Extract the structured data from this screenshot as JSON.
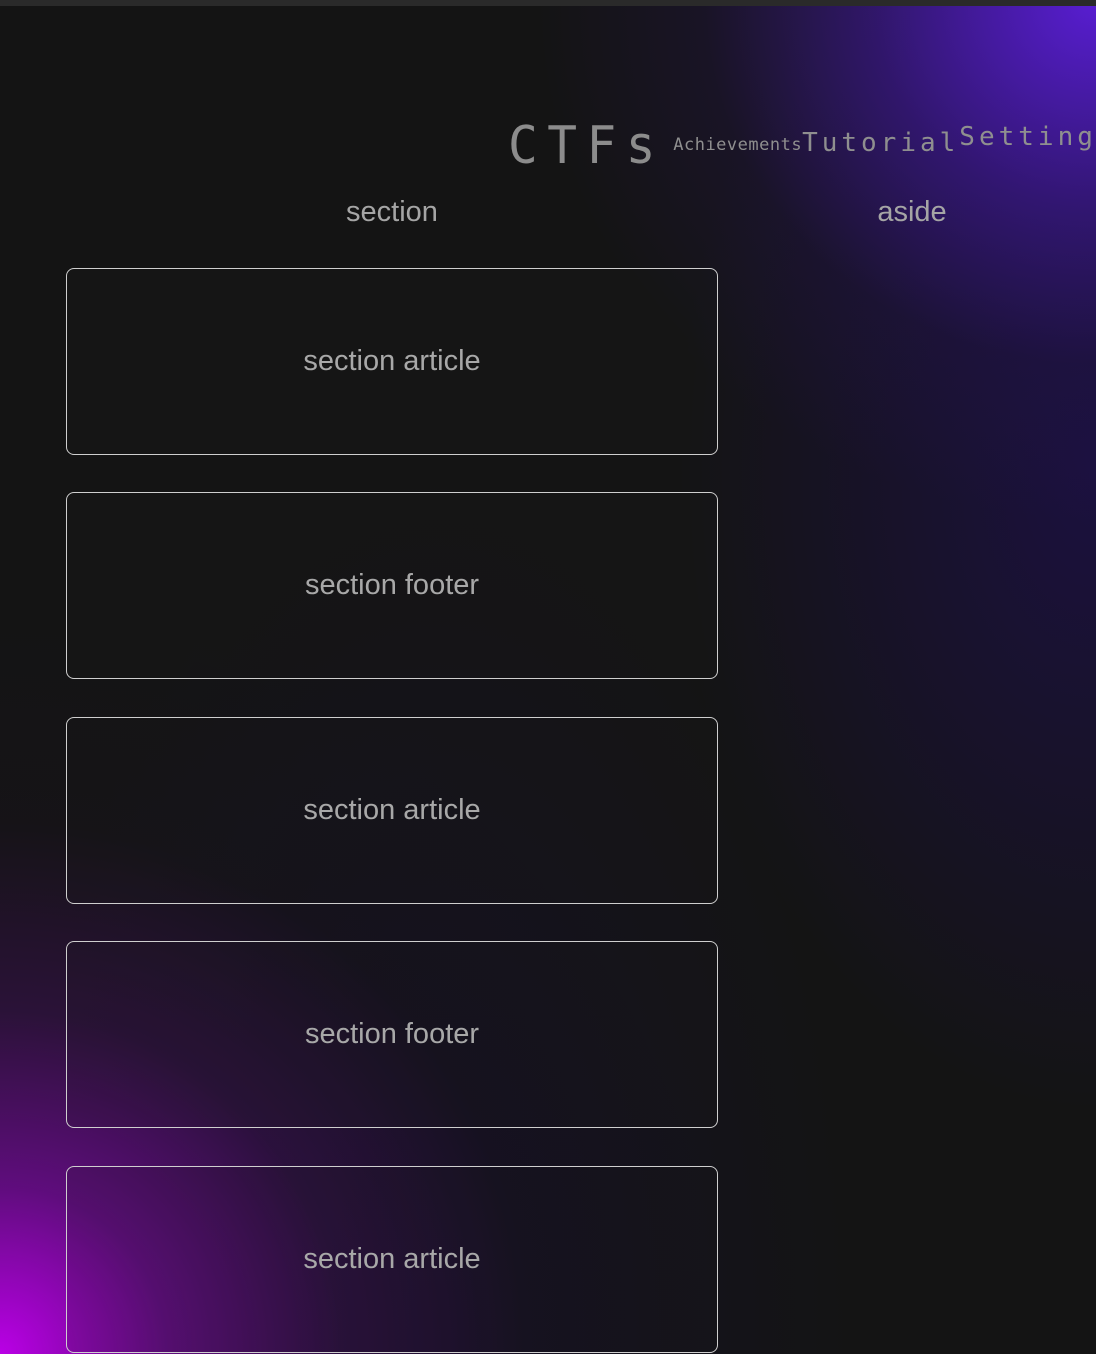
{
  "nav": {
    "logo": "CTFs",
    "links": [
      "Achievements",
      "Tutorial",
      "Settings"
    ]
  },
  "layout_labels": {
    "section": "section",
    "aside": "aside"
  },
  "cards": [
    {
      "label": "section article"
    },
    {
      "label": "section footer"
    },
    {
      "label": "section article"
    },
    {
      "label": "section footer"
    },
    {
      "label": "section article"
    }
  ],
  "colors": {
    "background": "#141414",
    "accent_purple": "#5c1edc",
    "accent_magenta": "#ba00e6",
    "card_border": "#cfcfcf",
    "text": "#a5a5a5"
  }
}
